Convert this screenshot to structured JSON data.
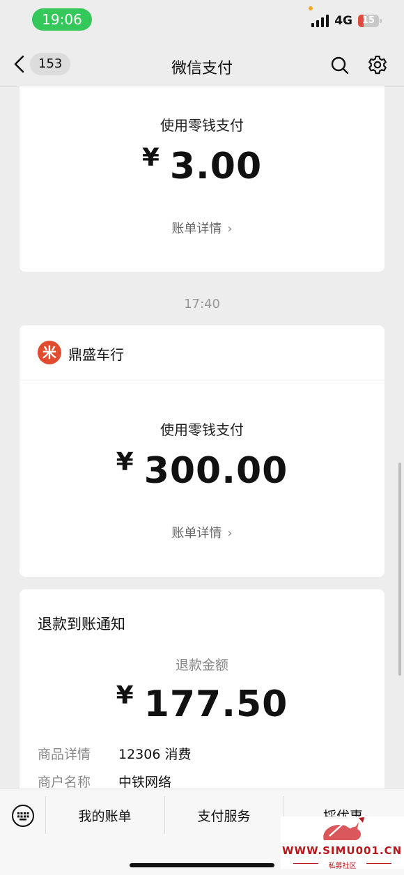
{
  "status": {
    "time": "19:06",
    "network": "4G",
    "battery": "15"
  },
  "nav": {
    "unread_count": "153",
    "title": "微信支付"
  },
  "card1": {
    "label": "使用零钱支付",
    "currency": "¥",
    "amount": "3.00",
    "detail_link": "账单详情",
    "arrow": "›"
  },
  "timestamp": "17:40",
  "card2": {
    "merchant_logo_char": "米",
    "merchant_name": "鼎盛车行",
    "label": "使用零钱支付",
    "currency": "¥",
    "amount": "300.00",
    "detail_link": "账单详情",
    "arrow": "›"
  },
  "card3": {
    "title": "退款到账通知",
    "amount_label": "退款金额",
    "currency": "¥",
    "amount": "177.50",
    "rows": [
      {
        "key": "商品详情",
        "value": "12306 消费"
      },
      {
        "key": "商户名称",
        "value": "中铁网络"
      }
    ]
  },
  "bottom_menu": [
    "我的账单",
    "支付服务",
    "採优惠"
  ],
  "watermark": {
    "text": "WWW.SIMU001.CN",
    "sub": "私募社区"
  },
  "colors": {
    "status_pill": "#34c759",
    "merchant_logo": "#e14b2f",
    "watermark": "#b8161b"
  }
}
